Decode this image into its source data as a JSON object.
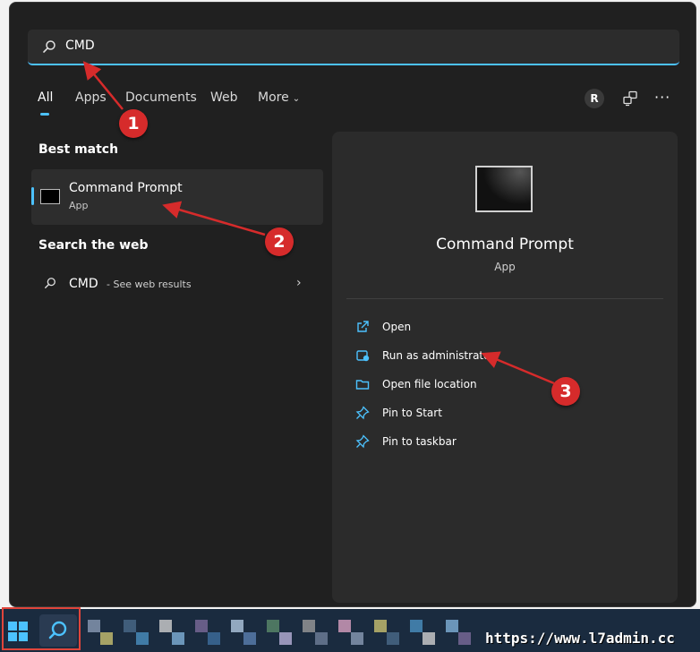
{
  "search": {
    "query": "CMD"
  },
  "tabs": [
    {
      "label": "All",
      "active": true
    },
    {
      "label": "Apps"
    },
    {
      "label": "Documents"
    },
    {
      "label": "Web"
    },
    {
      "label": "More"
    }
  ],
  "header": {
    "avatar_initial": "R",
    "more_options": "···"
  },
  "sections": {
    "best_match": "Best match",
    "search_web": "Search the web"
  },
  "best_match": {
    "name": "Command Prompt",
    "type": "App"
  },
  "web_result": {
    "query": "CMD",
    "suffix": " - See web results"
  },
  "detail": {
    "title": "Command Prompt",
    "subtitle": "App",
    "actions": [
      {
        "label": "Open",
        "icon": "open-icon"
      },
      {
        "label": "Run as administrator",
        "icon": "shield-admin-icon"
      },
      {
        "label": "Open file location",
        "icon": "folder-icon"
      },
      {
        "label": "Pin to Start",
        "icon": "pin-icon"
      },
      {
        "label": "Pin to taskbar",
        "icon": "pin-icon"
      }
    ]
  },
  "annotations": [
    "1",
    "2",
    "3"
  ],
  "watermark": "https://www.l7admin.cc",
  "colors": {
    "accent": "#4cc2ff",
    "panel": "#202020",
    "detail_panel": "#2b2b2b",
    "annotation": "#d62b2b",
    "taskbar": "#1a2b3f"
  }
}
